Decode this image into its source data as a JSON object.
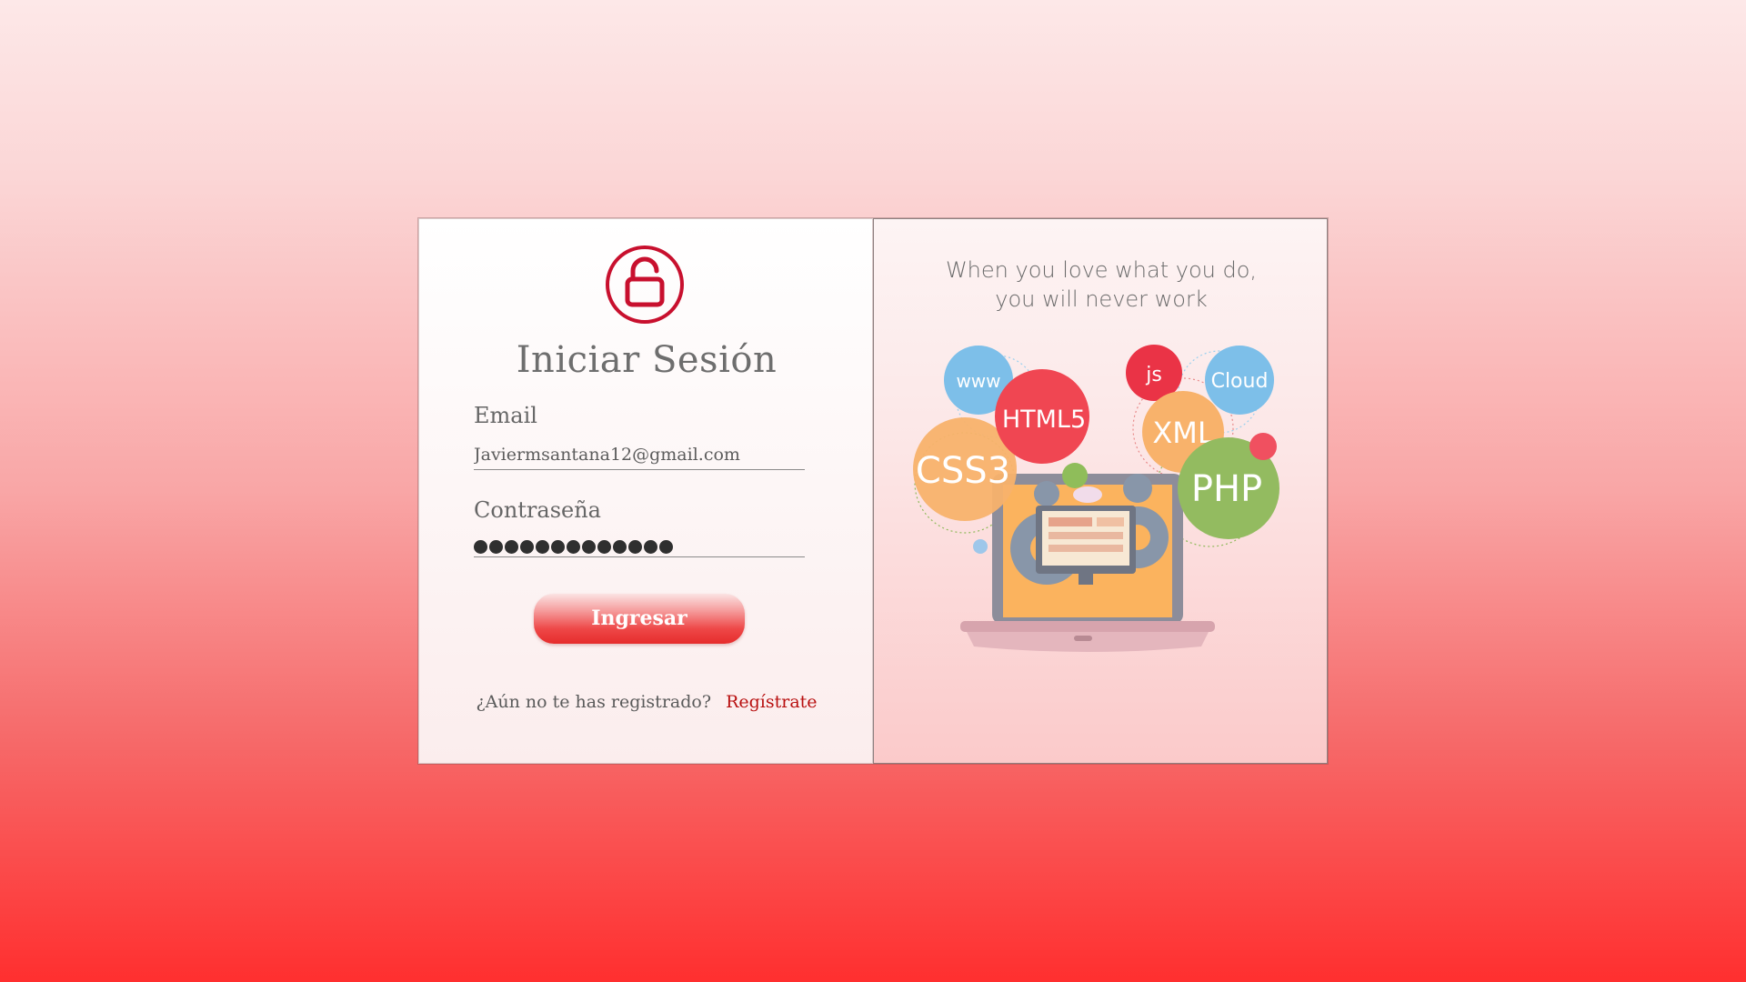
{
  "login": {
    "title": "Iniciar Sesión",
    "email_label": "Email",
    "email_value": "Javiermsantana12@gmail.com",
    "password_label": "Contraseña",
    "password_mask": "●●●●●●●●●●●●●",
    "password_length": 13,
    "submit_label": "Ingresar",
    "register_prompt": "¿Aún no te has registrado?",
    "register_link": "Regístrate",
    "lock_icon": "unlock-icon"
  },
  "promo": {
    "quote_line1": "When you love what you do,",
    "quote_line2": "you will never work",
    "bubbles": {
      "www": "www",
      "html5": "HTML5",
      "js": "js",
      "cloud": "Cloud",
      "css3": "CSS3",
      "xml": "XML",
      "php": "PHP"
    }
  },
  "colors": {
    "accent": "#c8102e",
    "link": "#b80f0f",
    "button": "#e62c2c",
    "html5": "#f0444f",
    "css3": "#f7b062",
    "php": "#8fb95a",
    "cloud": "#6fb8e8",
    "www": "#6fb8e8",
    "xml": "#f7b062",
    "js": "#ea3346"
  }
}
